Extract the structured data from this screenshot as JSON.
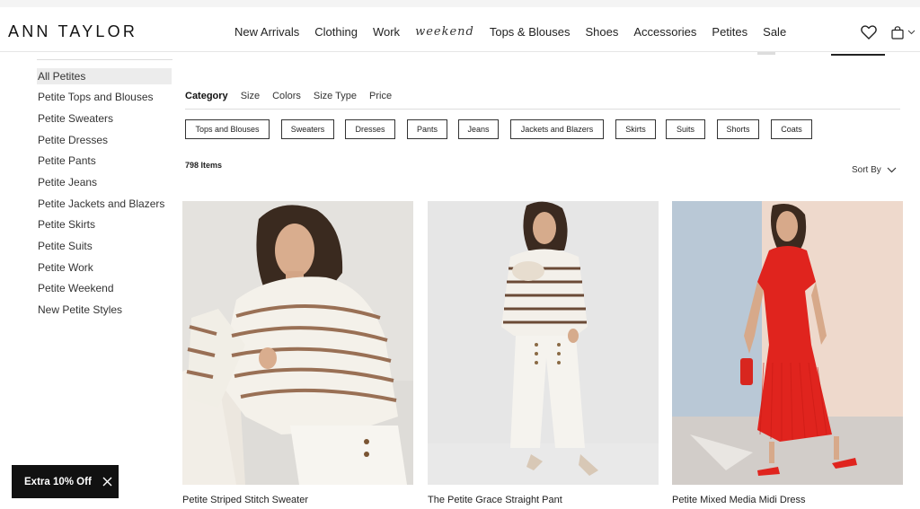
{
  "brand": {
    "logo": "ANN TAYLOR"
  },
  "nav": [
    {
      "label": "New Arrivals",
      "style": "normal"
    },
    {
      "label": "Clothing",
      "style": "normal"
    },
    {
      "label": "Work",
      "style": "normal"
    },
    {
      "label": "weekend",
      "style": "script"
    },
    {
      "label": "Tops & Blouses",
      "style": "normal"
    },
    {
      "label": "Shoes",
      "style": "normal"
    },
    {
      "label": "Accessories",
      "style": "normal"
    },
    {
      "label": "Petites",
      "style": "normal"
    },
    {
      "label": "Sale",
      "style": "normal"
    }
  ],
  "header_icons": [
    "heart-icon",
    "shopping-bag-icon",
    "chevron-down-icon"
  ],
  "sidebar": {
    "items": [
      {
        "label": "All Petites",
        "active": true
      },
      {
        "label": "Petite Tops and Blouses"
      },
      {
        "label": "Petite Sweaters"
      },
      {
        "label": "Petite Dresses"
      },
      {
        "label": "Petite Pants"
      },
      {
        "label": "Petite Jeans"
      },
      {
        "label": "Petite Jackets and Blazers"
      },
      {
        "label": "Petite Skirts"
      },
      {
        "label": "Petite Suits"
      },
      {
        "label": "Petite Work"
      },
      {
        "label": "Petite Weekend"
      },
      {
        "label": "New Petite Styles"
      }
    ]
  },
  "filters": {
    "tabs": [
      "Category",
      "Size",
      "Colors",
      "Size Type",
      "Price"
    ],
    "active_tab": "Category",
    "chips": [
      "Tops and Blouses",
      "Sweaters",
      "Dresses",
      "Pants",
      "Jeans",
      "Jackets and Blazers",
      "Skirts",
      "Suits",
      "Shorts",
      "Coats"
    ]
  },
  "results": {
    "count": "798 Items",
    "sort_label": "Sort By"
  },
  "products": [
    {
      "name": "Petite Striped Stitch Sweater"
    },
    {
      "name": "The Petite Grace Straight Pant"
    },
    {
      "name": "Petite Mixed Media Midi Dress"
    }
  ],
  "promo": {
    "label": "Extra 10% Off"
  },
  "colors": {
    "accent": "#111111",
    "chip_border": "#333333",
    "dress_red": "#e0241e"
  }
}
